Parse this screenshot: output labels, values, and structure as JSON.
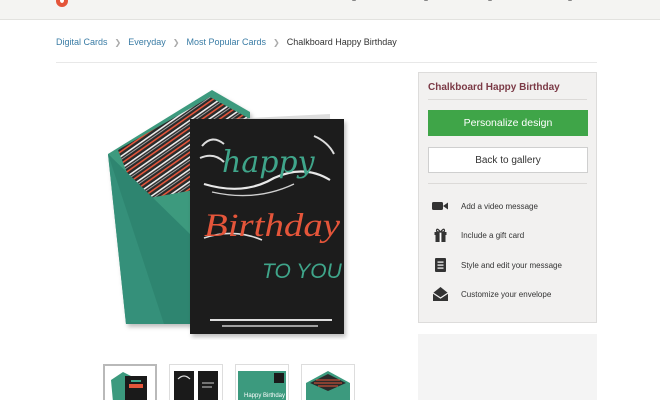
{
  "breadcrumb": {
    "items": [
      "Digital Cards",
      "Everyday",
      "Most Popular Cards"
    ],
    "current": "Chalkboard Happy Birthday"
  },
  "card": {
    "line1": "happy",
    "line2": "Birthday",
    "line3": "TO YOU"
  },
  "panel": {
    "title": "Chalkboard Happy Birthday",
    "primary_button": "Personalize design",
    "secondary_button": "Back to gallery",
    "features": [
      {
        "icon": "video-camera-icon",
        "label": "Add a video message"
      },
      {
        "icon": "gift-icon",
        "label": "Include a gift card"
      },
      {
        "icon": "document-icon",
        "label": "Style and edit your message"
      },
      {
        "icon": "envelope-icon",
        "label": "Customize your envelope"
      }
    ]
  },
  "thumbnails": {
    "inside_text": "Happy Birthday"
  },
  "colors": {
    "accent_green": "#3fa548",
    "title_maroon": "#7b3a46",
    "envelope_teal": "#3c9a7e",
    "chalkboard": "#1a1a1a",
    "link_blue": "#3a7ca5"
  }
}
